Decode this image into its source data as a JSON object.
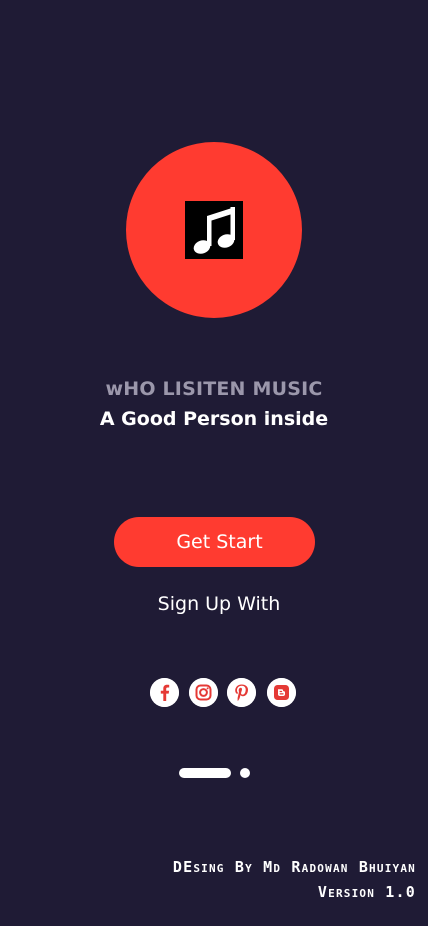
{
  "logo": {
    "icon": "music-note-icon",
    "circle_color": "#ff3b30"
  },
  "app_title": "wHO LISITEN MUSIC",
  "tagline": "A Good Person inside",
  "get_start_label": "Get Start",
  "signup_label": "Sign Up With",
  "social": [
    {
      "icon": "facebook-icon"
    },
    {
      "icon": "instagram-icon"
    },
    {
      "icon": "pinterest-icon"
    },
    {
      "icon": "blogger-icon"
    }
  ],
  "pager": {
    "pages": 2,
    "current": 1
  },
  "footer": {
    "credit": "DEsing By Md Radowan Bhuiyan",
    "version": "Version 1.0"
  },
  "colors": {
    "background": "#1f1b35",
    "accent": "#ff3b30",
    "muted_text": "#9b97ab"
  }
}
